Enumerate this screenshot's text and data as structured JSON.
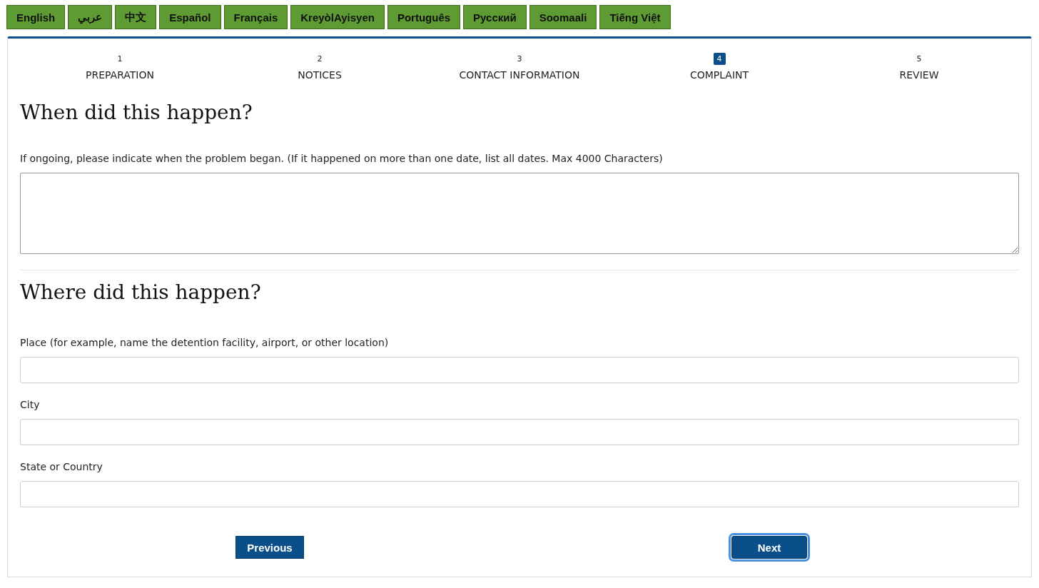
{
  "languages": [
    {
      "label": "English"
    },
    {
      "label": "عربي"
    },
    {
      "label": "中文"
    },
    {
      "label": "Español"
    },
    {
      "label": "Français"
    },
    {
      "label": "KreyòlAyisyen"
    },
    {
      "label": "Português"
    },
    {
      "label": "Русский"
    },
    {
      "label": "Soomaali"
    },
    {
      "label": "Tiếng Việt"
    }
  ],
  "steps": [
    {
      "number": "1",
      "label": "PREPARATION",
      "selected": false
    },
    {
      "number": "2",
      "label": "NOTICES",
      "selected": false
    },
    {
      "number": "3",
      "label": "CONTACT INFORMATION",
      "selected": false
    },
    {
      "number": "4",
      "label": "COMPLAINT",
      "selected": true
    },
    {
      "number": "5",
      "label": "REVIEW",
      "selected": false
    }
  ],
  "sections": [
    {
      "heading": "When did this happen?",
      "fields": [
        {
          "kind": "textarea",
          "label": "If ongoing, please indicate when the problem began. (If it happened on more than one date, list all dates. Max 4000 Characters)"
        }
      ]
    },
    {
      "heading": "Where did this happen?",
      "fields": [
        {
          "kind": "text",
          "label": "Place (for example, name the detention facility, airport, or other location)"
        },
        {
          "kind": "text",
          "label": "City"
        },
        {
          "kind": "text",
          "label": "State or Country"
        }
      ]
    }
  ],
  "buttons": [
    {
      "label": "Previous",
      "focused": false
    },
    {
      "label": "Next",
      "focused": true
    }
  ]
}
